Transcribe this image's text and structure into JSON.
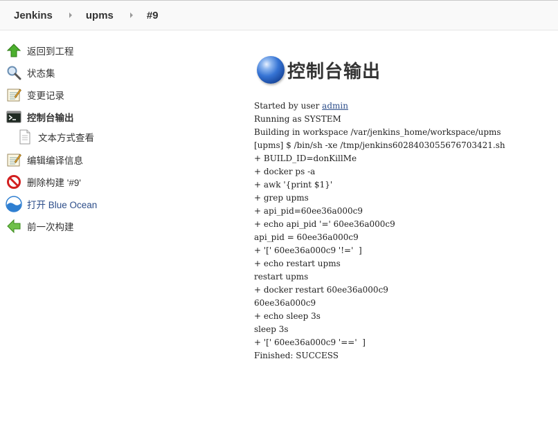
{
  "breadcrumb": [
    "Jenkins",
    "upms",
    "#9"
  ],
  "sidebar": {
    "items": [
      {
        "label": "返回到工程",
        "icon": "up-arrow-icon"
      },
      {
        "label": "状态集",
        "icon": "magnifier-icon"
      },
      {
        "label": "变更记录",
        "icon": "notepad-icon"
      },
      {
        "label": "控制台输出",
        "icon": "terminal-icon",
        "active": true
      },
      {
        "label": "文本方式查看",
        "icon": "document-icon",
        "sub": true
      },
      {
        "label": "编辑编译信息",
        "icon": "notepad-icon"
      },
      {
        "label": "删除构建 '#9'",
        "icon": "no-entry-icon"
      },
      {
        "label": "打开 Blue Ocean",
        "icon": "blue-ocean-icon"
      },
      {
        "label": "前一次构建",
        "icon": "left-arrow-icon"
      }
    ]
  },
  "main": {
    "title": "控制台输出",
    "console": {
      "started_prefix": "Started by user ",
      "started_user": "admin",
      "lines": [
        "Running as SYSTEM",
        "Building in workspace /var/jenkins_home/workspace/upms",
        "[upms] $ /bin/sh -xe /tmp/jenkins6028403055676703421.sh",
        "+ BUILD_ID=donKillMe",
        "+ docker ps -a",
        "+ awk '{print $1}'",
        "+ grep upms",
        "+ api_pid=60ee36a000c9",
        "+ echo api_pid '=' 60ee36a000c9",
        "api_pid = 60ee36a000c9",
        "+ '[' 60ee36a000c9 '!='  ]",
        "+ echo restart upms",
        "restart upms",
        "+ docker restart 60ee36a000c9",
        "60ee36a000c9",
        "+ echo sleep 3s",
        "sleep 3s",
        "+ '[' 60ee36a000c9 '=='  ]",
        "Finished: SUCCESS"
      ]
    }
  }
}
